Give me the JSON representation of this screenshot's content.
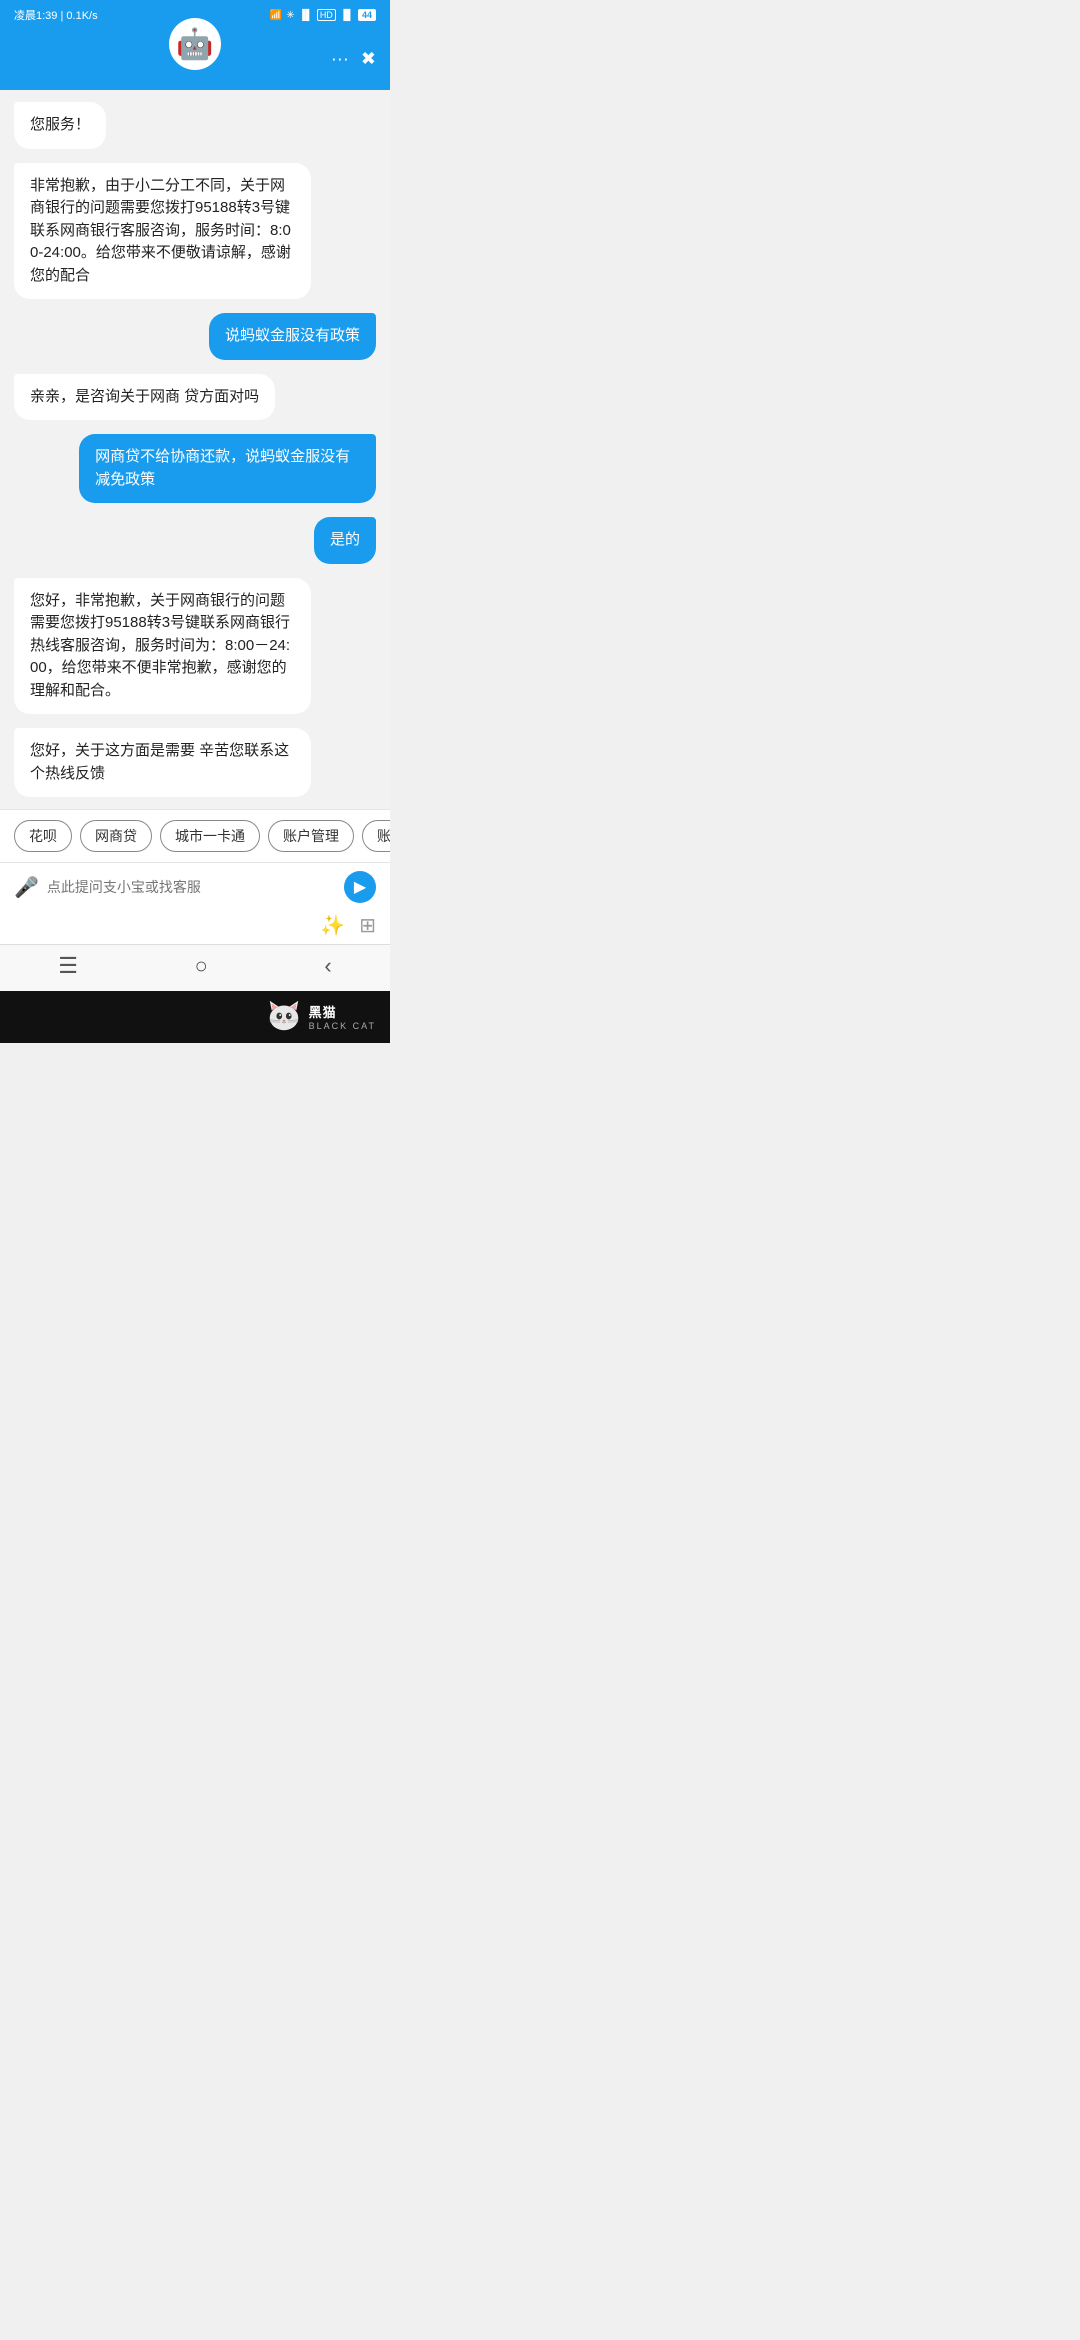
{
  "statusBar": {
    "time": "凌晨1:39",
    "speed": "0.1K/s",
    "battery": "44"
  },
  "header": {
    "moreLabel": "···",
    "avatarIcon": "🤖"
  },
  "messages": [
    {
      "id": 1,
      "type": "bot",
      "text": "您服务！"
    },
    {
      "id": 2,
      "type": "bot",
      "text": "非常抱歉，由于小二分工不同，关于网商银行的问题需要您拨打95188转3号键联系网商银行客服咨询，服务时间：8:00-24:00。给您带来不便敬请谅解，感谢您的配合"
    },
    {
      "id": 3,
      "type": "user",
      "text": "说蚂蚁金服没有政策"
    },
    {
      "id": 4,
      "type": "bot",
      "text": "亲亲，是咨询关于网商 贷方面对吗"
    },
    {
      "id": 5,
      "type": "user",
      "text": "网商贷不给协商还款，说蚂蚁金服没有减免政策"
    },
    {
      "id": 6,
      "type": "user",
      "text": "是的"
    },
    {
      "id": 7,
      "type": "bot",
      "text": "您好，非常抱歉，关于网商银行的问题需要您拨打95188转3号键联系网商银行热线客服咨询，服务时间为：8:00－24:00，给您带来不便非常抱歉，感谢您的理解和配合。"
    },
    {
      "id": 8,
      "type": "bot",
      "text": "您好，关于这方面是需要 辛苦您联系这个热线反馈"
    }
  ],
  "quickTags": [
    {
      "id": 1,
      "label": "花呗"
    },
    {
      "id": 2,
      "label": "网商贷"
    },
    {
      "id": 3,
      "label": "城市一卡通"
    },
    {
      "id": 4,
      "label": "账户管理"
    },
    {
      "id": 5,
      "label": "账..."
    }
  ],
  "inputArea": {
    "placeholder": "点此提问支小宝或找客服"
  },
  "brand": {
    "text": "黑猫",
    "subtext": "BLACK CAT"
  }
}
